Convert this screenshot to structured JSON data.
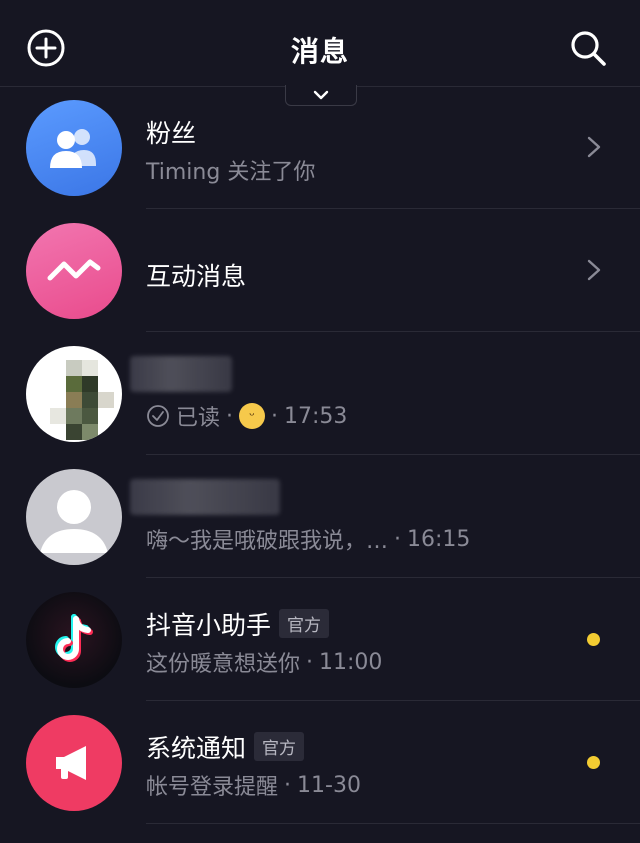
{
  "header": {
    "title": "消息",
    "add_icon": "plus-circle-icon",
    "search_icon": "search-icon",
    "collapse_icon": "chevron-down-icon"
  },
  "messages": [
    {
      "type": "fans",
      "title": "粉丝",
      "subtitle": "Timing 关注了你",
      "icon": "fans-icon",
      "color": "#4a86f0",
      "chevron": true
    },
    {
      "type": "interaction",
      "title": "互动消息",
      "icon": "interaction-wave-icon",
      "color": "#ee5c9c",
      "chevron": true
    },
    {
      "type": "chat",
      "title": "",
      "read_status": "已读",
      "emoji": "grinning-emoji",
      "time": "17:53"
    },
    {
      "type": "chat",
      "title": "",
      "preview": "嗨～我是哦破跟我说，…",
      "time": "16:15"
    },
    {
      "type": "official",
      "title": "抖音小助手",
      "badge": "官方",
      "preview": "这份暖意想送你",
      "time": "11:00",
      "icon": "tiktok-logo-icon",
      "unread": true
    },
    {
      "type": "official",
      "title": "系统通知",
      "badge": "官方",
      "preview": "帐号登录提醒",
      "time": "11-30",
      "icon": "megaphone-icon",
      "color": "#ef3b63",
      "unread": true
    }
  ],
  "separator": "·",
  "colors": {
    "background": "#161622",
    "unread_dot": "#f3cc32",
    "secondary_text": "#8a8a96"
  }
}
